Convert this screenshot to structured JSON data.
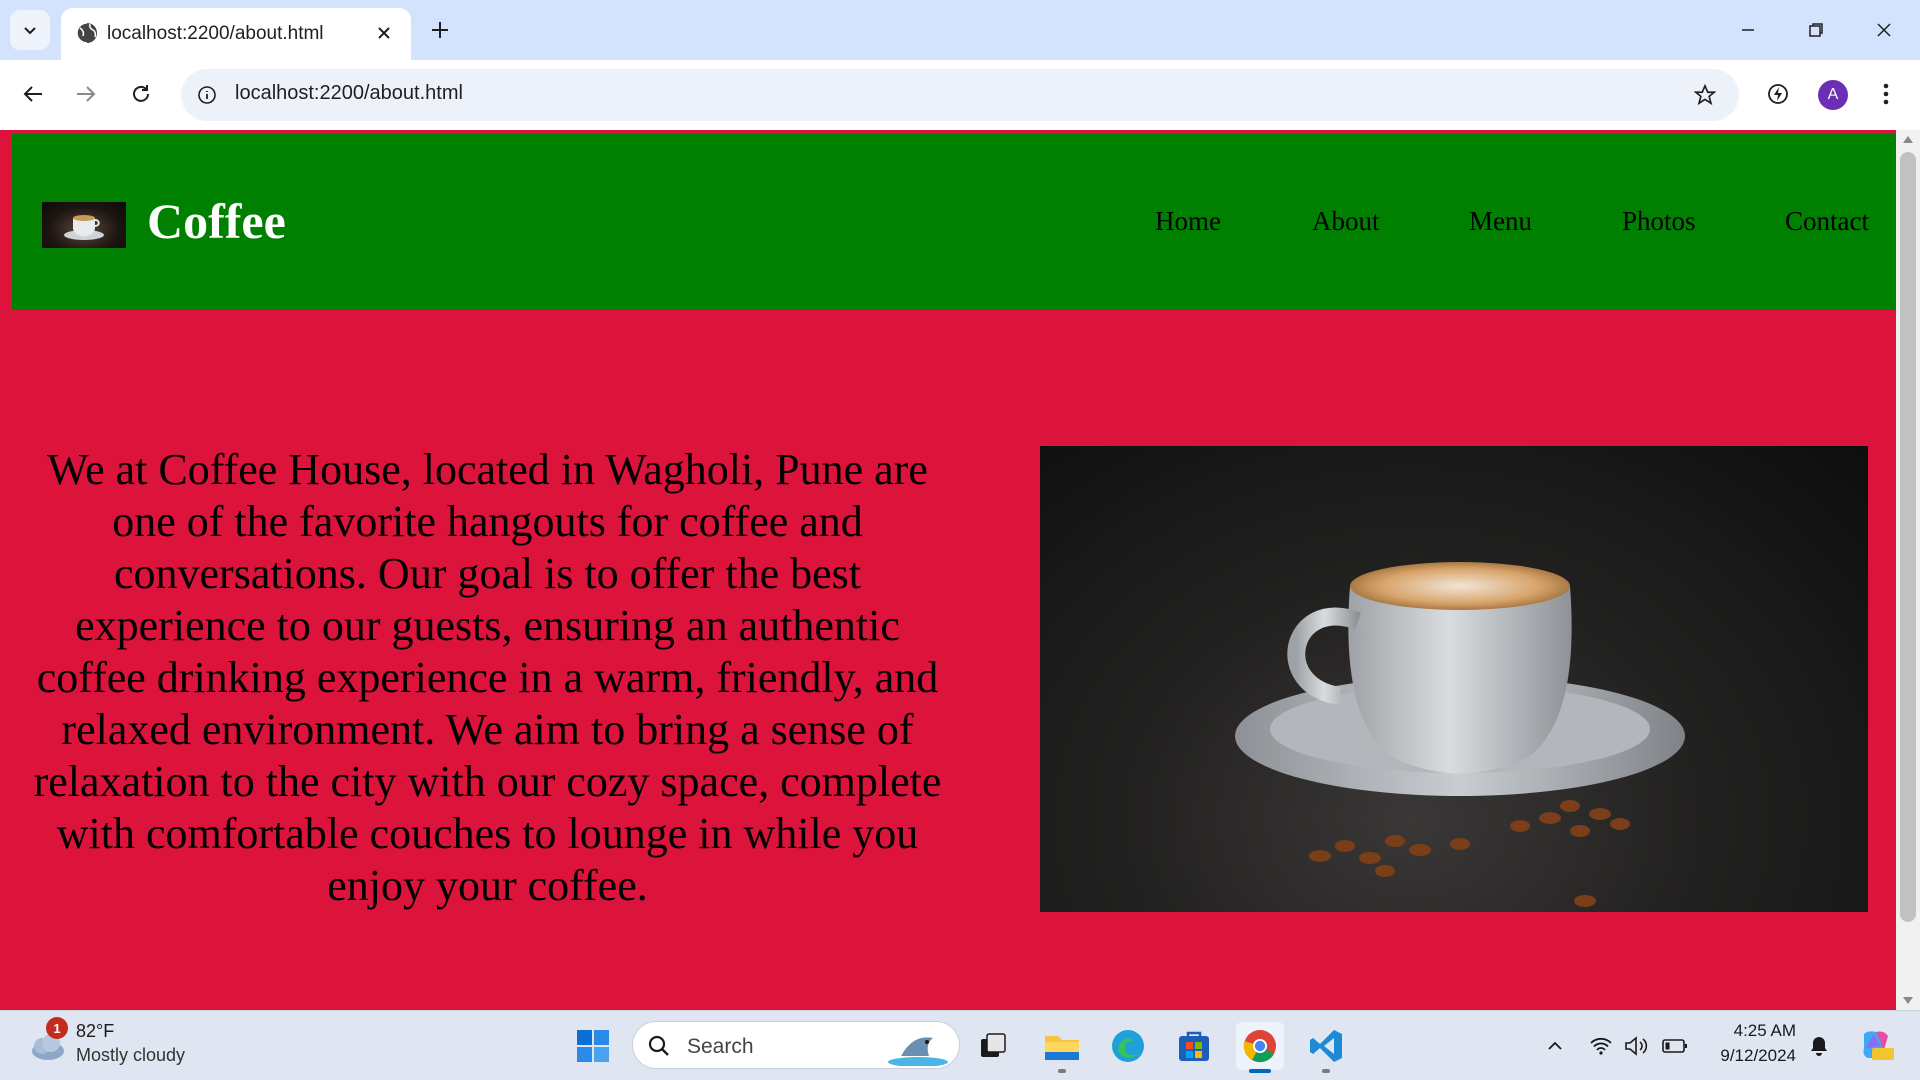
{
  "browser": {
    "tab_title": "localhost:2200/about.html",
    "url": "localhost:2200/about.html",
    "profile_initial": "A"
  },
  "site": {
    "brand": "Coffee",
    "nav": [
      "Home",
      "About",
      "Menu",
      "Photos",
      "Contact"
    ],
    "about_text": "We at Coffee House, located in Wagholi, Pune are one of the favorite hangouts for coffee and conversations. Our goal is to offer the best experience to our guests, ensuring an authentic coffee drinking experience in a warm, friendly, and relaxed environment. We aim to bring a sense of relaxation to the city with our cozy space, complete with comfortable couches to lounge in while you enjoy your coffee.",
    "colors": {
      "header": "#008000",
      "body": "#dc143c",
      "nav_text": "#000000",
      "brand_text": "#ffffff"
    }
  },
  "taskbar": {
    "weather_temp": "82°F",
    "weather_desc": "Mostly cloudy",
    "weather_badge": "1",
    "search_label": "Search",
    "time": "4:25 AM",
    "date": "9/12/2024"
  }
}
